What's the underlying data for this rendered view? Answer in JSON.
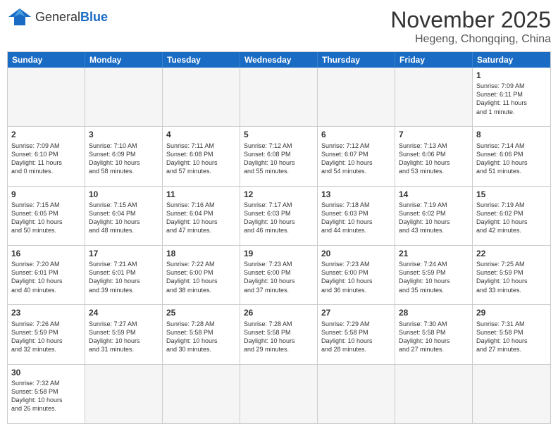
{
  "header": {
    "logo_general": "General",
    "logo_blue": "Blue",
    "month_title": "November 2025",
    "location": "Hegeng, Chongqing, China"
  },
  "day_headers": [
    "Sunday",
    "Monday",
    "Tuesday",
    "Wednesday",
    "Thursday",
    "Friday",
    "Saturday"
  ],
  "weeks": [
    {
      "days": [
        {
          "num": "",
          "text": ""
        },
        {
          "num": "",
          "text": ""
        },
        {
          "num": "",
          "text": ""
        },
        {
          "num": "",
          "text": ""
        },
        {
          "num": "",
          "text": ""
        },
        {
          "num": "",
          "text": ""
        },
        {
          "num": "1",
          "text": "Sunrise: 7:09 AM\nSunset: 6:11 PM\nDaylight: 11 hours\nand 1 minute."
        }
      ]
    },
    {
      "days": [
        {
          "num": "2",
          "text": "Sunrise: 7:09 AM\nSunset: 6:10 PM\nDaylight: 11 hours\nand 0 minutes."
        },
        {
          "num": "3",
          "text": "Sunrise: 7:10 AM\nSunset: 6:09 PM\nDaylight: 10 hours\nand 58 minutes."
        },
        {
          "num": "4",
          "text": "Sunrise: 7:11 AM\nSunset: 6:08 PM\nDaylight: 10 hours\nand 57 minutes."
        },
        {
          "num": "5",
          "text": "Sunrise: 7:12 AM\nSunset: 6:08 PM\nDaylight: 10 hours\nand 55 minutes."
        },
        {
          "num": "6",
          "text": "Sunrise: 7:12 AM\nSunset: 6:07 PM\nDaylight: 10 hours\nand 54 minutes."
        },
        {
          "num": "7",
          "text": "Sunrise: 7:13 AM\nSunset: 6:06 PM\nDaylight: 10 hours\nand 53 minutes."
        },
        {
          "num": "8",
          "text": "Sunrise: 7:14 AM\nSunset: 6:06 PM\nDaylight: 10 hours\nand 51 minutes."
        }
      ]
    },
    {
      "days": [
        {
          "num": "9",
          "text": "Sunrise: 7:15 AM\nSunset: 6:05 PM\nDaylight: 10 hours\nand 50 minutes."
        },
        {
          "num": "10",
          "text": "Sunrise: 7:15 AM\nSunset: 6:04 PM\nDaylight: 10 hours\nand 48 minutes."
        },
        {
          "num": "11",
          "text": "Sunrise: 7:16 AM\nSunset: 6:04 PM\nDaylight: 10 hours\nand 47 minutes."
        },
        {
          "num": "12",
          "text": "Sunrise: 7:17 AM\nSunset: 6:03 PM\nDaylight: 10 hours\nand 46 minutes."
        },
        {
          "num": "13",
          "text": "Sunrise: 7:18 AM\nSunset: 6:03 PM\nDaylight: 10 hours\nand 44 minutes."
        },
        {
          "num": "14",
          "text": "Sunrise: 7:19 AM\nSunset: 6:02 PM\nDaylight: 10 hours\nand 43 minutes."
        },
        {
          "num": "15",
          "text": "Sunrise: 7:19 AM\nSunset: 6:02 PM\nDaylight: 10 hours\nand 42 minutes."
        }
      ]
    },
    {
      "days": [
        {
          "num": "16",
          "text": "Sunrise: 7:20 AM\nSunset: 6:01 PM\nDaylight: 10 hours\nand 40 minutes."
        },
        {
          "num": "17",
          "text": "Sunrise: 7:21 AM\nSunset: 6:01 PM\nDaylight: 10 hours\nand 39 minutes."
        },
        {
          "num": "18",
          "text": "Sunrise: 7:22 AM\nSunset: 6:00 PM\nDaylight: 10 hours\nand 38 minutes."
        },
        {
          "num": "19",
          "text": "Sunrise: 7:23 AM\nSunset: 6:00 PM\nDaylight: 10 hours\nand 37 minutes."
        },
        {
          "num": "20",
          "text": "Sunrise: 7:23 AM\nSunset: 6:00 PM\nDaylight: 10 hours\nand 36 minutes."
        },
        {
          "num": "21",
          "text": "Sunrise: 7:24 AM\nSunset: 5:59 PM\nDaylight: 10 hours\nand 35 minutes."
        },
        {
          "num": "22",
          "text": "Sunrise: 7:25 AM\nSunset: 5:59 PM\nDaylight: 10 hours\nand 33 minutes."
        }
      ]
    },
    {
      "days": [
        {
          "num": "23",
          "text": "Sunrise: 7:26 AM\nSunset: 5:59 PM\nDaylight: 10 hours\nand 32 minutes."
        },
        {
          "num": "24",
          "text": "Sunrise: 7:27 AM\nSunset: 5:59 PM\nDaylight: 10 hours\nand 31 minutes."
        },
        {
          "num": "25",
          "text": "Sunrise: 7:28 AM\nSunset: 5:58 PM\nDaylight: 10 hours\nand 30 minutes."
        },
        {
          "num": "26",
          "text": "Sunrise: 7:28 AM\nSunset: 5:58 PM\nDaylight: 10 hours\nand 29 minutes."
        },
        {
          "num": "27",
          "text": "Sunrise: 7:29 AM\nSunset: 5:58 PM\nDaylight: 10 hours\nand 28 minutes."
        },
        {
          "num": "28",
          "text": "Sunrise: 7:30 AM\nSunset: 5:58 PM\nDaylight: 10 hours\nand 27 minutes."
        },
        {
          "num": "29",
          "text": "Sunrise: 7:31 AM\nSunset: 5:58 PM\nDaylight: 10 hours\nand 27 minutes."
        }
      ]
    },
    {
      "days": [
        {
          "num": "30",
          "text": "Sunrise: 7:32 AM\nSunset: 5:58 PM\nDaylight: 10 hours\nand 26 minutes."
        },
        {
          "num": "",
          "text": ""
        },
        {
          "num": "",
          "text": ""
        },
        {
          "num": "",
          "text": ""
        },
        {
          "num": "",
          "text": ""
        },
        {
          "num": "",
          "text": ""
        },
        {
          "num": "",
          "text": ""
        }
      ]
    }
  ]
}
